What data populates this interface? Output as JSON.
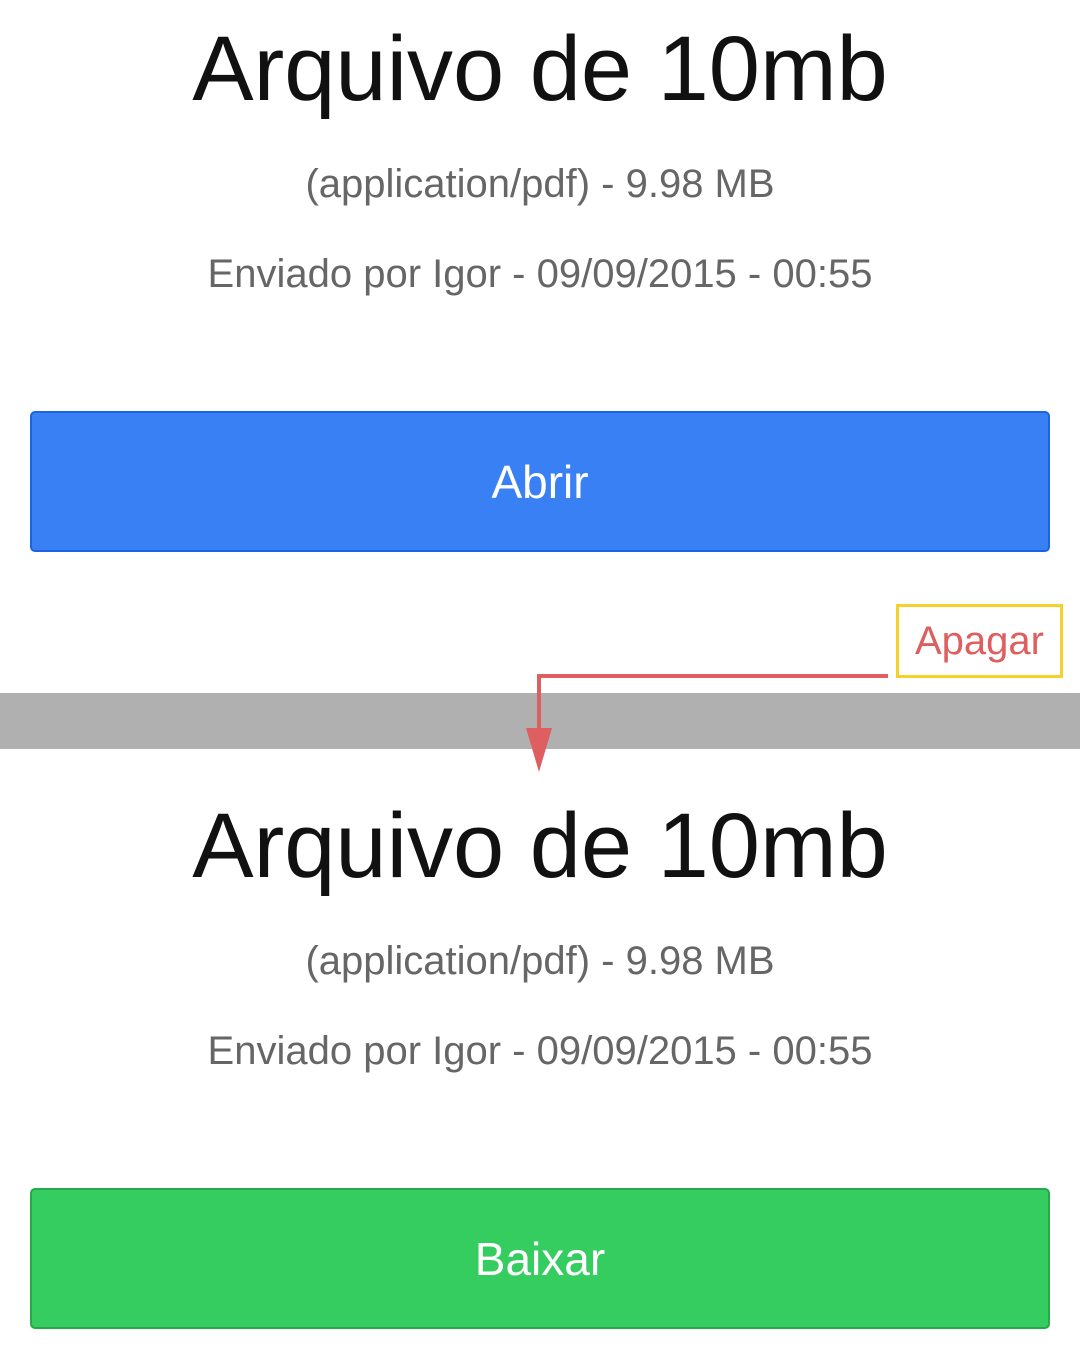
{
  "top_panel": {
    "title": "Arquivo de 10mb",
    "type_line": "(application/pdf) - 9.98 MB",
    "sender_line": "Enviado por Igor - 09/09/2015 - 00:55",
    "open_label": "Abrir"
  },
  "annotation": {
    "delete_label": "Apagar",
    "arrow_color": "#dd5f5f",
    "box_color": "#f5d22a"
  },
  "bottom_panel": {
    "title": "Arquivo de 10mb",
    "type_line": "(application/pdf) - 9.98 MB",
    "sender_line": "Enviado por Igor - 09/09/2015 - 00:55",
    "download_label": "Baixar"
  },
  "colors": {
    "open_button": "#3a80f5",
    "download_button": "#35cc60",
    "divider": "#b0b0b0"
  }
}
